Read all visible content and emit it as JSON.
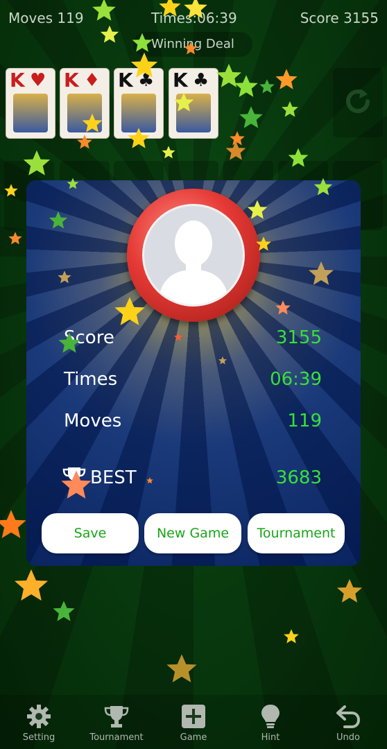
{
  "status": {
    "moves": "Moves 119",
    "time": "Times:06:39",
    "score": "Score 3155",
    "banner": "Winning Deal"
  },
  "foundations": [
    {
      "rank": "K",
      "suit": "♥",
      "color": "red"
    },
    {
      "rank": "K",
      "suit": "♦",
      "color": "red"
    },
    {
      "rank": "K",
      "suit": "♣",
      "color": "black"
    },
    {
      "rank": "K",
      "suit": "♣",
      "color": "black"
    }
  ],
  "results": {
    "score_label": "Score",
    "score_value": "3155",
    "times_label": "Times",
    "times_value": "06:39",
    "moves_label": "Moves",
    "moves_value": "119",
    "best_label": "BEST",
    "best_value": "3683"
  },
  "buttons": {
    "save": "Save",
    "new_game": "New Game",
    "tournament": "Tournament"
  },
  "nav": {
    "setting": "Setting",
    "tournament": "Tournament",
    "game": "Game",
    "hint": "Hint",
    "undo": "Undo"
  },
  "colors": {
    "accent_green": "#38e038",
    "button_text": "#18a518",
    "dialog_blue": "#0a2460",
    "ring_red": "#e53935"
  },
  "icons": [
    "gear-icon",
    "trophy-icon",
    "plus-icon",
    "bulb-icon",
    "undo-icon",
    "refresh-icon",
    "avatar-icon"
  ]
}
